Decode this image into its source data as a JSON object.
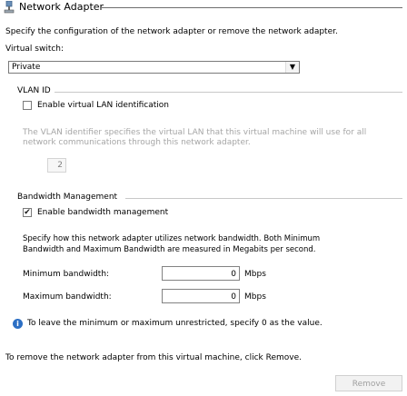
{
  "header": {
    "title": "Network Adapter",
    "icon": "network-adapter-icon"
  },
  "description": "Specify the configuration of the network adapter or remove the network adapter.",
  "virtual_switch": {
    "label": "Virtual switch:",
    "selected": "Private"
  },
  "vlan": {
    "title": "VLAN ID",
    "checkbox_label": "Enable virtual LAN identification",
    "checked": false,
    "help_line1": "The VLAN identifier specifies the virtual LAN that this virtual machine will use for all",
    "help_line2": "network communications through this network adapter.",
    "value": "2"
  },
  "bandwidth": {
    "title": "Bandwidth Management",
    "checkbox_label": "Enable bandwidth management",
    "checked": true,
    "help_line1": "Specify how this network adapter utilizes network bandwidth. Both Minimum",
    "help_line2": "Bandwidth and Maximum Bandwidth are measured in Megabits per second.",
    "min_label": "Minimum bandwidth:",
    "min_value": "0",
    "max_label": "Maximum bandwidth:",
    "max_value": "0",
    "unit": "Mbps",
    "info": "To leave the minimum or maximum unrestricted, specify 0 as the value.",
    "info_icon": "info-icon"
  },
  "footer": {
    "remove_text": "To remove the network adapter from this virtual machine, click Remove.",
    "remove_button": "Remove"
  },
  "colors": {
    "info_blue": "#2c6fc4",
    "disabled_text": "#a6a6a6"
  }
}
